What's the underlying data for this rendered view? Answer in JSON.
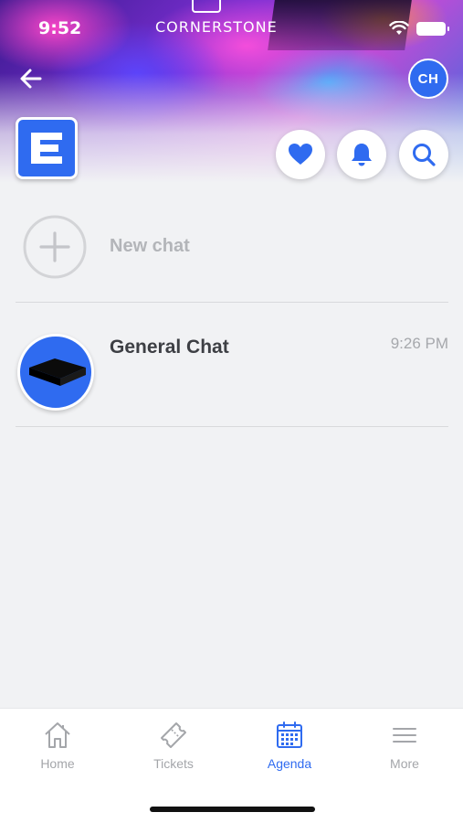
{
  "status_bar": {
    "time": "9:52",
    "wifi_icon": "wifi-icon",
    "battery_icon": "battery-icon"
  },
  "header": {
    "brand": "CORNERSTONE",
    "back_icon": "arrow-left-icon",
    "user_initials": "CH",
    "accent_color": "#2f6bf0",
    "actions": {
      "favorites_icon": "heart-icon",
      "notifications_icon": "bell-icon",
      "search_icon": "search-icon"
    }
  },
  "chat_list": {
    "new_chat_label": "New chat",
    "items": [
      {
        "title": "General Chat",
        "time": "9:26 PM",
        "avatar_icon": "box-icon"
      }
    ]
  },
  "tab_bar": {
    "tabs": [
      {
        "label": "Home",
        "icon": "home-icon",
        "active": false
      },
      {
        "label": "Tickets",
        "icon": "ticket-icon",
        "active": false
      },
      {
        "label": "Agenda",
        "icon": "calendar-icon",
        "active": true
      },
      {
        "label": "More",
        "icon": "menu-icon",
        "active": false
      }
    ]
  }
}
